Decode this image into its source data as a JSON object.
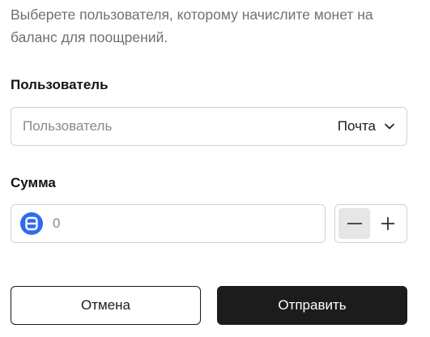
{
  "description": "Выберете пользователя, которому начислите монет на баланс для поощрений.",
  "user": {
    "label": "Пользователь",
    "placeholder": "Пользователь",
    "type_selected": "Почта",
    "type_icon": "chevron-down-icon"
  },
  "sum": {
    "label": "Сумма",
    "placeholder": "0",
    "coin_icon": "coin-icon",
    "coin_color": "#2f6bf2",
    "minus_icon": "minus-icon",
    "plus_icon": "plus-icon"
  },
  "actions": {
    "cancel_label": "Отмена",
    "submit_label": "Отправить"
  },
  "colors": {
    "submit_bg": "#1c1c1c",
    "border": "#d2d2d2",
    "description_text": "#707070"
  }
}
